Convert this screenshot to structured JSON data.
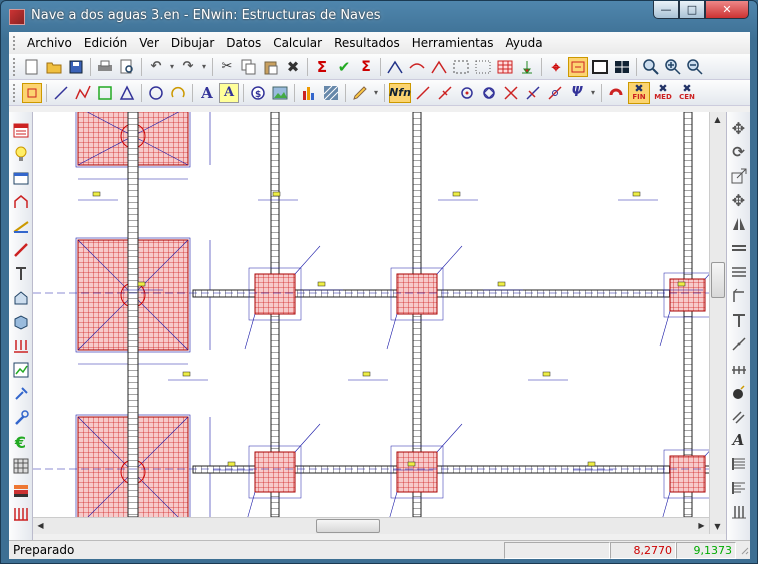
{
  "window": {
    "title": "Nave a dos aguas 3.en - ENwin: Estructuras de Naves"
  },
  "menu": [
    "Archivo",
    "Edición",
    "Ver",
    "Dibujar",
    "Datos",
    "Calcular",
    "Resultados",
    "Herramientas",
    "Ayuda"
  ],
  "toolbar1": [
    "new-icon",
    "open-icon",
    "save-icon",
    "print-icon",
    "print-preview-icon",
    "undo-icon",
    "redo-icon",
    "cut-icon",
    "copy-icon",
    "paste-icon",
    "delete-icon",
    "sum-icon",
    "check-icon",
    "calc-icon",
    "node-icon",
    "bar-icon",
    "truss-icon",
    "grid-icon",
    "select-icon",
    "table-icon",
    "support-icon",
    "snap-icon",
    "mark-icon",
    "window-icon",
    "grid4-icon",
    "zoom-icon",
    "zoom-in-icon",
    "zoom-out-icon"
  ],
  "toolbar2": {
    "nfn_label": "Nfn",
    "text_a_label": "A",
    "fin_label": "FIN",
    "med_label": "MED",
    "cen_label": "CEN"
  },
  "status": {
    "text": "Preparado",
    "coord_x": "8,2770",
    "coord_y": "9,1373"
  },
  "colors": {
    "accent": "#d9343a",
    "coord_x_color": "#cc0000",
    "coord_y_color": "#00aa00",
    "drawing_blue": "#1a1aa8",
    "slab_red": "#e05050"
  }
}
